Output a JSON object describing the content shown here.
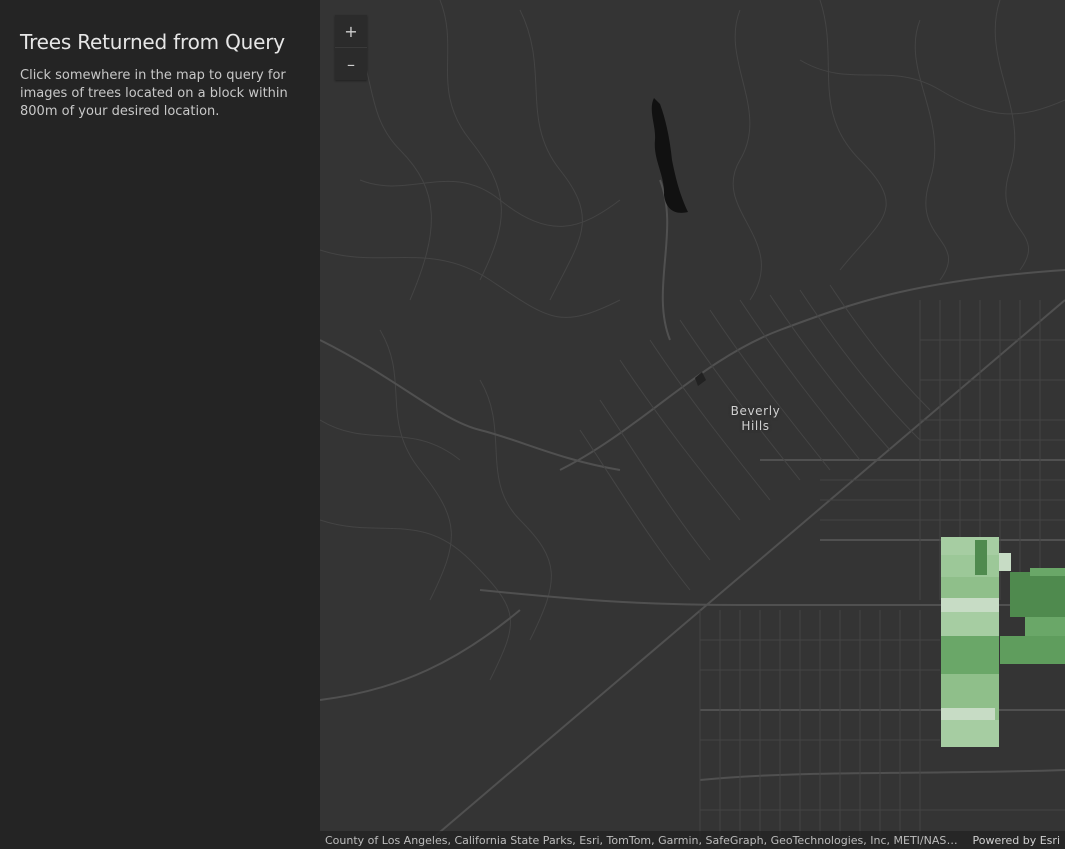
{
  "sidebar": {
    "title": "Trees Returned from Query",
    "description": "Click somewhere in the map to query for images of trees located on a block within 800m of your desired location."
  },
  "map": {
    "zoom_in_label": "+",
    "zoom_out_label": "–",
    "place_label_line1": "Beverly",
    "place_label_line2": "Hills",
    "attribution": "County of Los Angeles, California State Parks, Esri, TomTom, Garmin, SafeGraph, GeoTechnologies, Inc, METI/NASA, …",
    "powered_by": "Powered by Esri",
    "basemap_color": "#343434",
    "road_color": "#4a4a4a",
    "water_color": "#111111",
    "tree_palette": [
      "#a6cda2",
      "#8fbf8a",
      "#6aa768",
      "#4f8a4e",
      "#c7dcc5"
    ]
  }
}
